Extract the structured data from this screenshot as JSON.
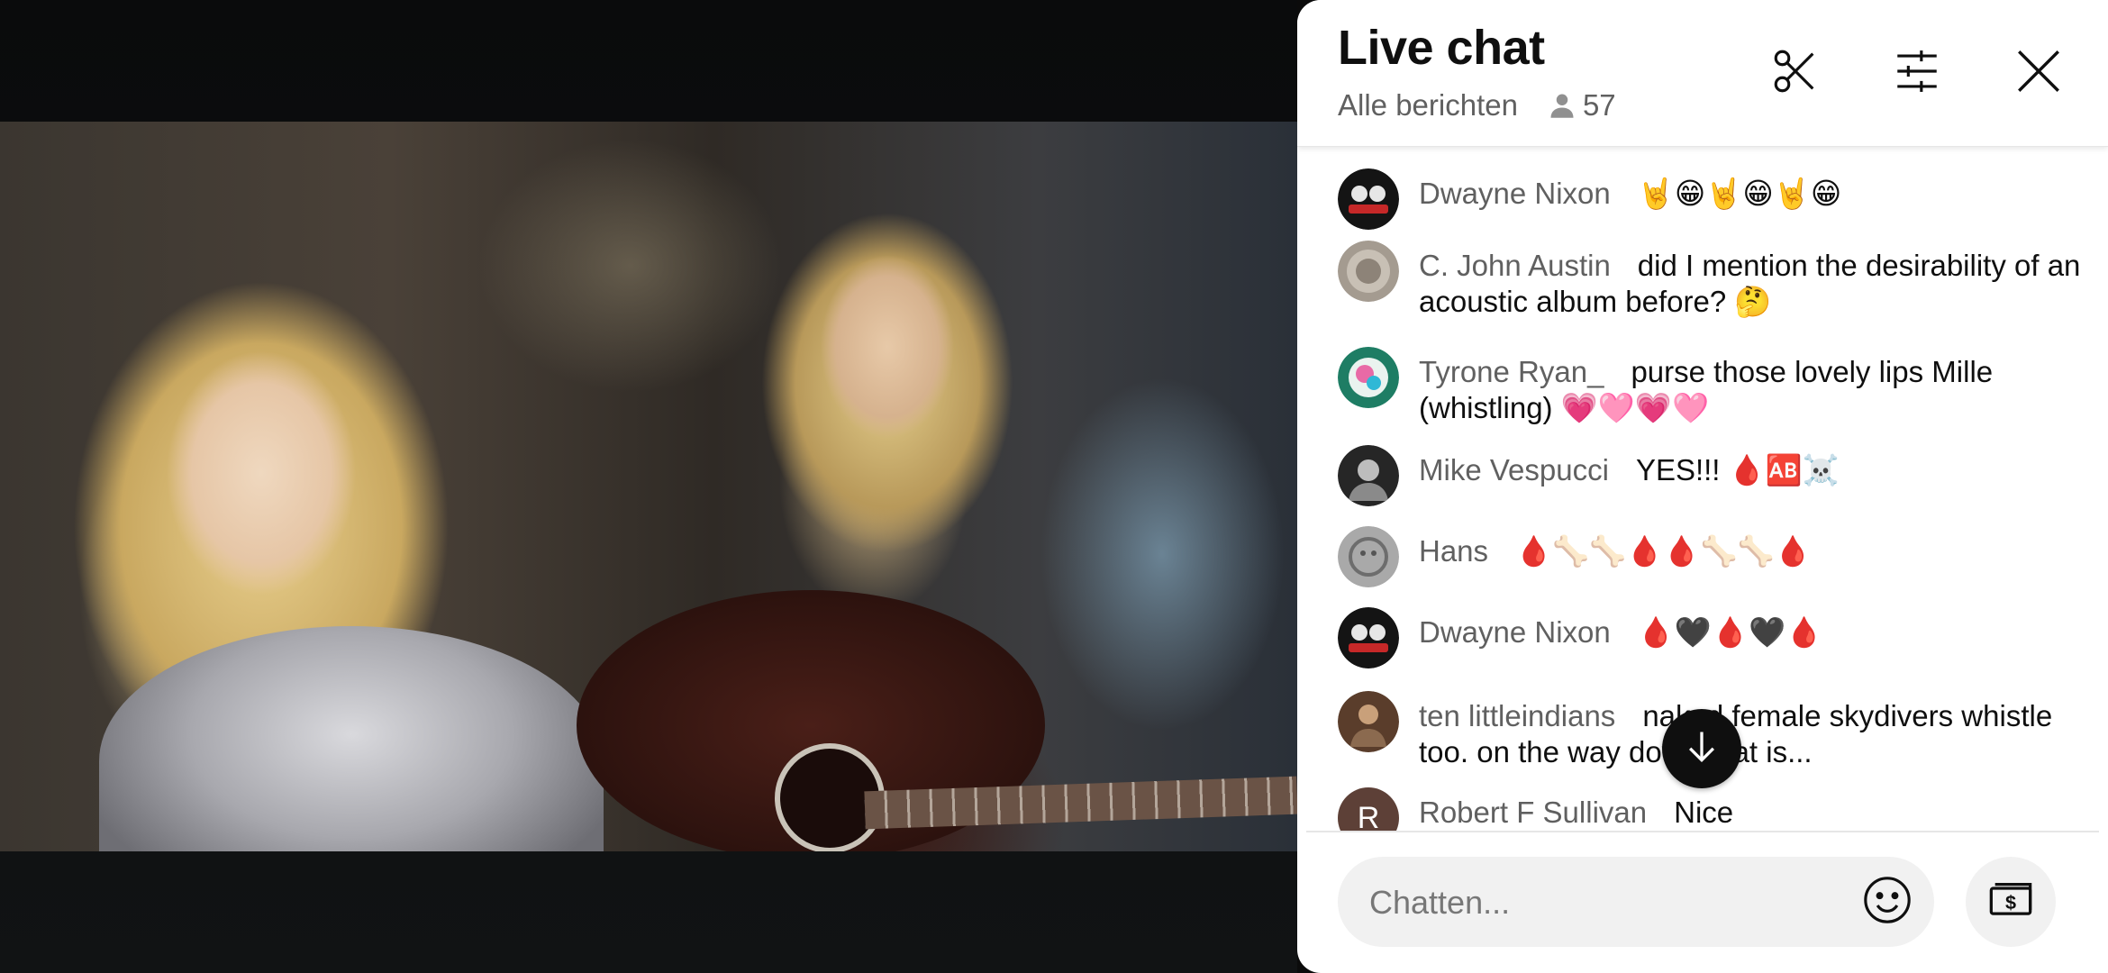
{
  "chat": {
    "title": "Live chat",
    "filter_label": "Alle berichten",
    "viewer_count": "57",
    "input_placeholder": "Chatten...",
    "messages": [
      {
        "author": "Dwayne Nixon",
        "text": "🤘😁🤘😁🤘😁",
        "avatar_letter": "",
        "avatar_color": "#1b1b1b"
      },
      {
        "author": "C. John Austin",
        "text": "did I mention the desirability of an acoustic album before? 🤔",
        "avatar_letter": "",
        "avatar_color": "#9c9388"
      },
      {
        "author": "Tyrone Ryan_",
        "text": "purse those lovely lips Mille (whistling) 💗🩷💗🩷",
        "avatar_letter": "",
        "avatar_color": "#2a9b7b"
      },
      {
        "author": "Mike Vespucci",
        "text": "YES!!! 🩸🆎☠️",
        "avatar_letter": "",
        "avatar_color": "#2b2b2b"
      },
      {
        "author": "Hans",
        "text": "🩸🦴🦴🩸🩸🦴🦴🩸",
        "avatar_letter": "",
        "avatar_color": "#9a9a9a"
      },
      {
        "author": "Dwayne Nixon",
        "text": "🩸🖤🩸🖤🩸",
        "avatar_letter": "",
        "avatar_color": "#1b1b1b"
      },
      {
        "author": "ten littleindians",
        "text": "naked female skydivers whistle too. on the way down that is...",
        "avatar_letter": "",
        "avatar_color": "#6b4a36"
      },
      {
        "author": "Robert F Sullivan",
        "text": "Nice",
        "avatar_letter": "R",
        "avatar_color": "#5d4037"
      }
    ]
  },
  "icons": {
    "clip": "scissors-icon",
    "filter": "sliders-icon",
    "close": "close-icon",
    "viewers": "person-icon",
    "scroll": "arrow-down-icon",
    "emoji": "smiley-icon",
    "superchat": "dollar-bill-icon"
  },
  "colors": {
    "panel_bg": "#ffffff",
    "author_text": "#606060",
    "message_text": "#0f0f0f",
    "input_bg": "#f1f1f1",
    "fab_bg": "#0f0f0f"
  }
}
